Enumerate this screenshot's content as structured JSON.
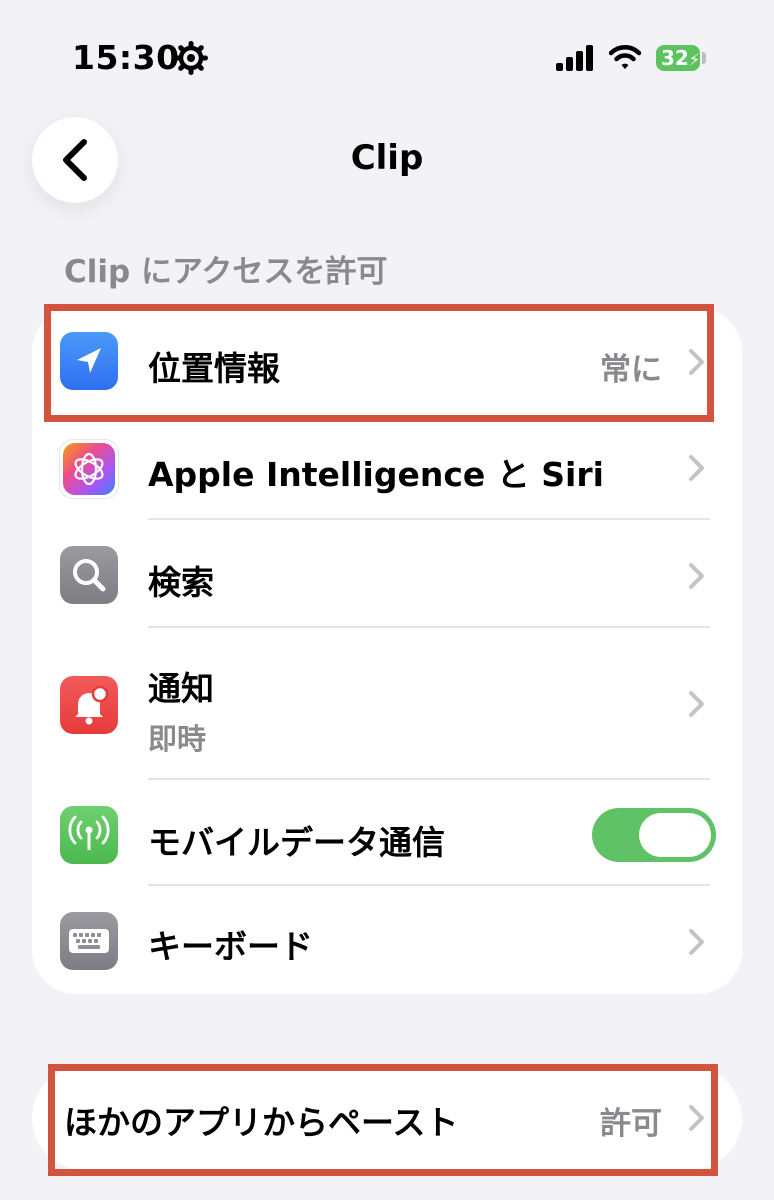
{
  "status_bar": {
    "time": "15:30",
    "battery": "32"
  },
  "nav": {
    "title": "Clip"
  },
  "section_header": "Clip にアクセスを許可",
  "rows": [
    {
      "label": "位置情報",
      "value": "常に",
      "icon": "location-arrow-icon",
      "color": "#3b82f6"
    },
    {
      "label": "Apple Intelligence と Siri",
      "icon": "apple-intelligence-icon"
    },
    {
      "label": "検索",
      "icon": "search-icon",
      "color": "#8e8e93"
    },
    {
      "label": "通知",
      "sub": "即時",
      "icon": "notification-bell-icon",
      "color": "#ef4444"
    },
    {
      "label": "モバイルデータ通信",
      "toggle": true,
      "icon": "cellular-antenna-icon",
      "color": "#5cc35f"
    },
    {
      "label": "キーボード",
      "icon": "keyboard-icon",
      "color": "#8e8e93"
    }
  ],
  "paste": {
    "label": "ほかのアプリからペースト",
    "value": "許可"
  },
  "colors": {
    "highlight": "#d2543f",
    "toggle_on": "#5fc267",
    "secondary_text": "#8a8a8e"
  }
}
